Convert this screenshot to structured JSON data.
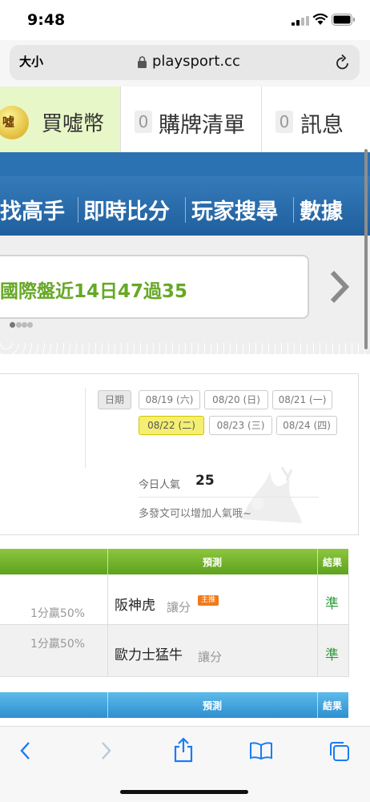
{
  "status_bar": {
    "time": "9:48"
  },
  "browser": {
    "text_size_label": "大小",
    "url": "playsport.cc"
  },
  "top_nav": {
    "buy_coin": "買噓幣",
    "coin_logo_char": "噓",
    "cart_count": "0",
    "cart_label": "購牌清單",
    "msg_count": "0",
    "msg_label": "訊息"
  },
  "menu": {
    "items": [
      "找高手",
      "即時比分",
      "玩家搜尋",
      "數據"
    ]
  },
  "notice": {
    "text": "國際盤近14日47過35"
  },
  "date_panel": {
    "label": "日期",
    "dates": [
      "08/19 (六)",
      "08/20 (日)",
      "08/21 (一)",
      "08/22 (二)",
      "08/23 (三)",
      "08/24 (四)"
    ],
    "selected_index": 3,
    "popularity_label": "今日人氣",
    "popularity_value": "25",
    "tip": "多發文可以增加人氣哦~"
  },
  "table1": {
    "header_predict": "預測",
    "header_result": "結果",
    "rows": [
      {
        "odds": "1分贏50%",
        "team": "阪神虎",
        "pick": "讓分",
        "badge": "主推",
        "result": "準"
      },
      {
        "odds": "1分贏50%",
        "team": "歐力士猛牛",
        "pick": "讓分",
        "result": "準"
      }
    ]
  },
  "table2": {
    "header_predict": "預測",
    "header_result": "結果"
  },
  "colors": {
    "menu_blue": "#1f5f9e",
    "green_header": "#6aad27",
    "blue_header": "#2e8fd0",
    "result_green": "#2d9a3a",
    "selected_date": "#f4ef72"
  },
  "toolbar": {
    "icons": [
      "back-icon",
      "forward-icon",
      "share-icon",
      "bookmarks-icon",
      "tabs-icon"
    ]
  }
}
